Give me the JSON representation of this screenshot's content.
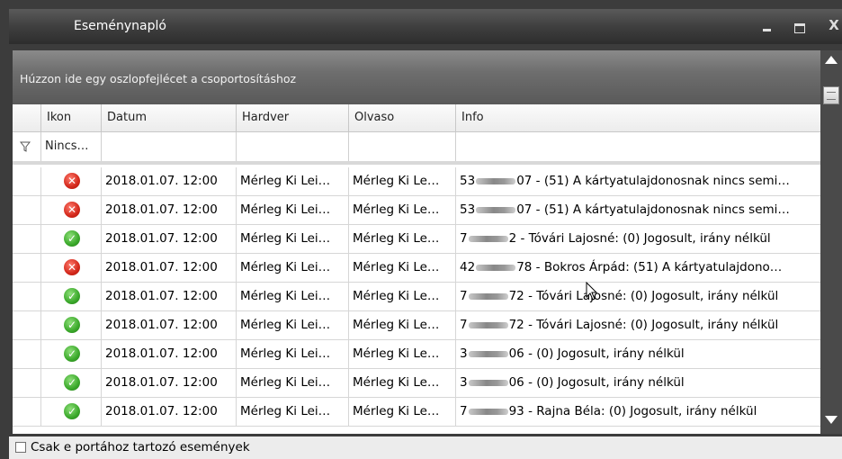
{
  "window": {
    "title": "Eseménynapló",
    "close_label": "X"
  },
  "grid": {
    "group_hint": "Húzzon ide egy oszlopfejlécet a csoportosításhoz",
    "columns": [
      "Ikon",
      "Datum",
      "Hardver",
      "Olvaso",
      "Info"
    ],
    "filter": {
      "ikon": "Nincs…"
    },
    "rows": [
      {
        "status": "error",
        "datum": "2018.01.07. 12:00",
        "hardver": "Mérleg Ki Lei…",
        "olvaso": "Mérleg Ki Le…",
        "info_pre": "53",
        "info_post": "07 - (51) A kártyatulajdonosnak nincs semi…"
      },
      {
        "status": "error",
        "datum": "2018.01.07. 12:00",
        "hardver": "Mérleg Ki Lei…",
        "olvaso": "Mérleg Ki Le…",
        "info_pre": "53",
        "info_post": "07 - (51) A kártyatulajdonosnak nincs semi…"
      },
      {
        "status": "ok",
        "datum": "2018.01.07. 12:00",
        "hardver": "Mérleg Ki Lei…",
        "olvaso": "Mérleg Ki Le…",
        "info_pre": "7",
        "info_post": "2 - Tóvári Lajosné: (0) Jogosult, irány nélkül"
      },
      {
        "status": "error",
        "datum": "2018.01.07. 12:00",
        "hardver": "Mérleg Ki Lei…",
        "olvaso": "Mérleg Ki Le…",
        "info_pre": "42",
        "info_post": "78 - Bokros Árpád: (51) A kártyatulajdono…"
      },
      {
        "status": "ok",
        "datum": "2018.01.07. 12:00",
        "hardver": "Mérleg Ki Lei…",
        "olvaso": "Mérleg Ki Le…",
        "info_pre": "7",
        "info_post": "72 - Tóvári Lajosné: (0) Jogosult, irány nélkül"
      },
      {
        "status": "ok",
        "datum": "2018.01.07. 12:00",
        "hardver": "Mérleg Ki Lei…",
        "olvaso": "Mérleg Ki Le…",
        "info_pre": "7",
        "info_post": "72 - Tóvári Lajosné: (0) Jogosult, irány nélkül"
      },
      {
        "status": "ok",
        "datum": "2018.01.07. 12:00",
        "hardver": "Mérleg Ki Lei…",
        "olvaso": "Mérleg Ki Le…",
        "info_pre": "3",
        "info_post": "06 - (0) Jogosult, irány nélkül"
      },
      {
        "status": "ok",
        "datum": "2018.01.07. 12:00",
        "hardver": "Mérleg Ki Lei…",
        "olvaso": "Mérleg Ki Le…",
        "info_pre": "3",
        "info_post": "06 - (0) Jogosult, irány nélkül"
      },
      {
        "status": "ok",
        "datum": "2018.01.07. 12:00",
        "hardver": "Mérleg Ki Lei…",
        "olvaso": "Mérleg Ki Le…",
        "info_pre": "7",
        "info_post": "93 - Rajna Béla: (0) Jogosult, irány nélkül"
      }
    ]
  },
  "footer": {
    "checkbox_label": "Csak e portához tartozó események",
    "checked": false
  },
  "icons": {
    "error": "error-x-icon",
    "ok": "check-ok-icon",
    "filter": "filter-funnel-icon"
  },
  "colors": {
    "error": "#d3281b",
    "ok": "#3aa82a",
    "titlebar": "#3f3f3f"
  }
}
